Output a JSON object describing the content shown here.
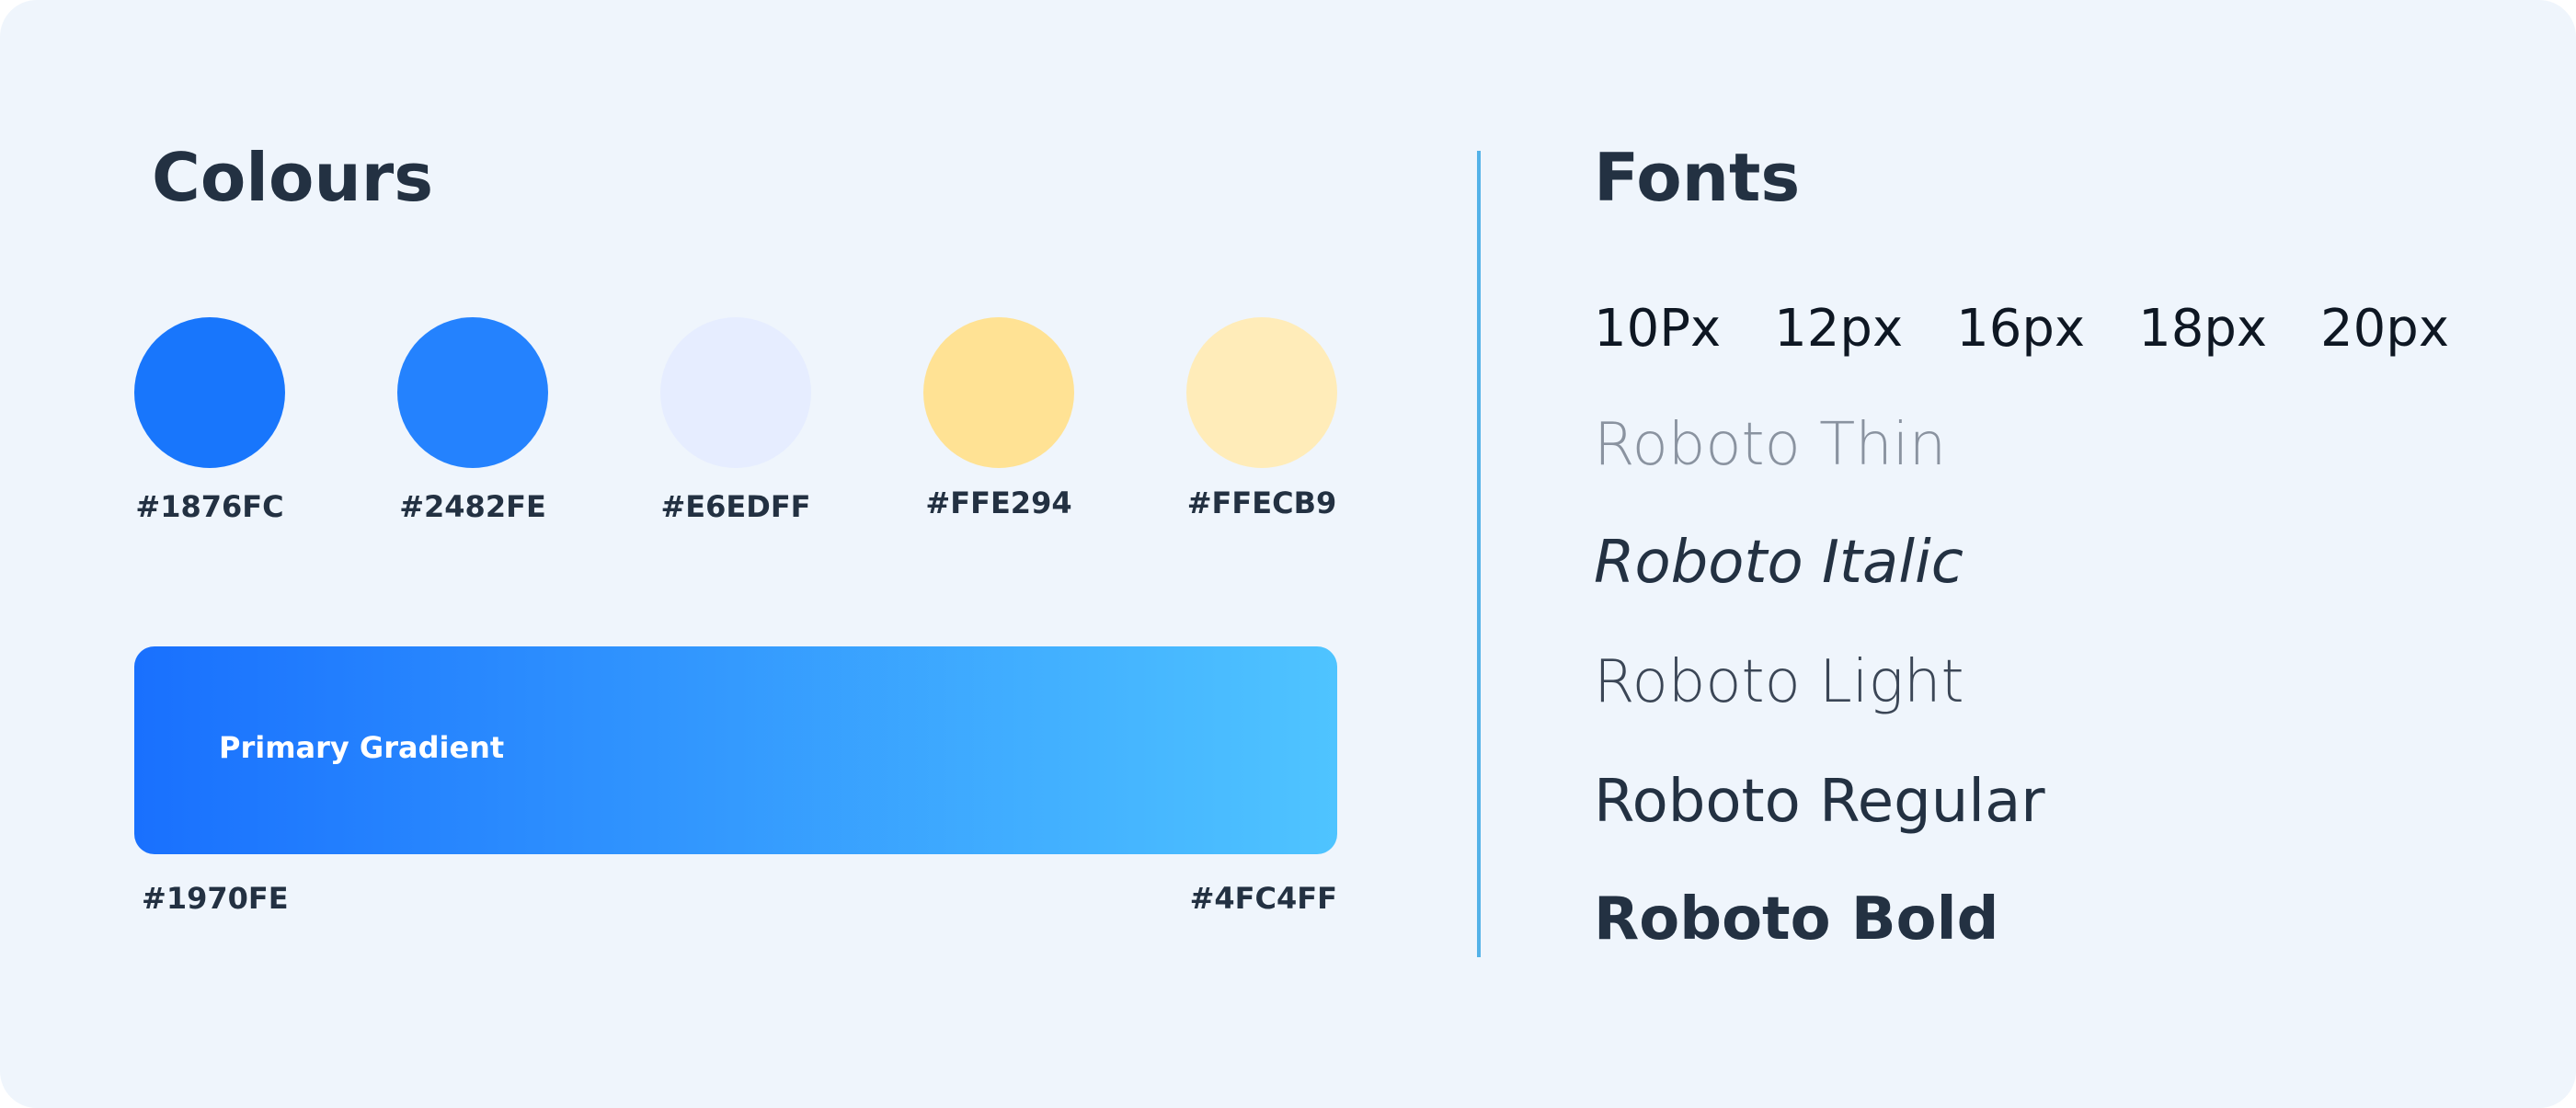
{
  "colours": {
    "title": "Colours",
    "swatches": [
      {
        "label": "#1876FC",
        "color": "#1876FC"
      },
      {
        "label": "#2482FE",
        "color": "#2482FE"
      },
      {
        "label": "#E6EDFF",
        "color": "#E6EDFF"
      },
      {
        "label": "#FFE294",
        "color": "#FFE294"
      },
      {
        "label": "#FFECB9",
        "color": "#FFECB9"
      }
    ],
    "gradient": {
      "label": "Primary Gradient",
      "start_label": "#1970FE",
      "end_label": "#4FC4FF",
      "start_color": "#1970FE",
      "end_color": "#4FC4FF"
    }
  },
  "fonts": {
    "title": "Fonts",
    "sizes": [
      "10Px",
      "12px",
      "16px",
      "18px",
      "20px"
    ],
    "samples": {
      "thin": "Roboto Thin",
      "italic": "Roboto Italic",
      "light": "Roboto Light",
      "regular": "Roboto Regular",
      "bold": "Roboto Bold"
    }
  },
  "theme": {
    "card_background": "#EFF5FC",
    "text_color": "#233142",
    "divider_color": "#54B2E8"
  }
}
